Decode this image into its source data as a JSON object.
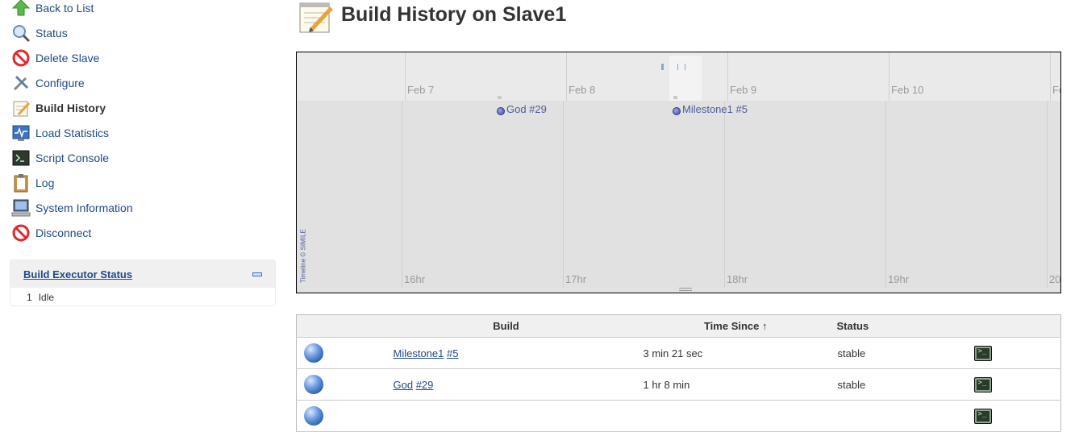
{
  "sidebar": {
    "tasks": [
      {
        "label": "Back to List",
        "icon": "up-arrow-icon"
      },
      {
        "label": "Status",
        "icon": "magnifier-icon"
      },
      {
        "label": "Delete Slave",
        "icon": "no-entry-icon"
      },
      {
        "label": "Configure",
        "icon": "tools-icon"
      },
      {
        "label": "Build History",
        "icon": "notepad-icon"
      },
      {
        "label": "Load Statistics",
        "icon": "chart-monitor-icon"
      },
      {
        "label": "Script Console",
        "icon": "terminal-icon"
      },
      {
        "label": "Log",
        "icon": "clipboard-icon"
      },
      {
        "label": "System Information",
        "icon": "computer-icon"
      },
      {
        "label": "Disconnect",
        "icon": "no-entry-icon"
      }
    ],
    "executor": {
      "title": "Build Executor Status",
      "rows": [
        {
          "num": "1",
          "state": "Idle"
        }
      ]
    }
  },
  "main": {
    "title": "Build History on Slave1",
    "timeline": {
      "dates": [
        "Feb 7",
        "Feb 8",
        "Feb 9",
        "Feb 10",
        "Fe"
      ],
      "hours": [
        "16hr",
        "17hr",
        "18hr",
        "19hr",
        "20"
      ],
      "events": [
        "God #29",
        "Milestone1 #5"
      ],
      "credit": "Timeline © SIMILE"
    },
    "table": {
      "headers": {
        "build": "Build",
        "time_since": "Time Since",
        "sort_arrow": "↑",
        "status": "Status"
      },
      "rows": [
        {
          "job": "Milestone1",
          "number": "#5",
          "time": "3 min 21 sec",
          "status": "stable"
        },
        {
          "job": "God",
          "number": "#29",
          "time": "1 hr 8 min",
          "status": "stable"
        }
      ]
    }
  }
}
